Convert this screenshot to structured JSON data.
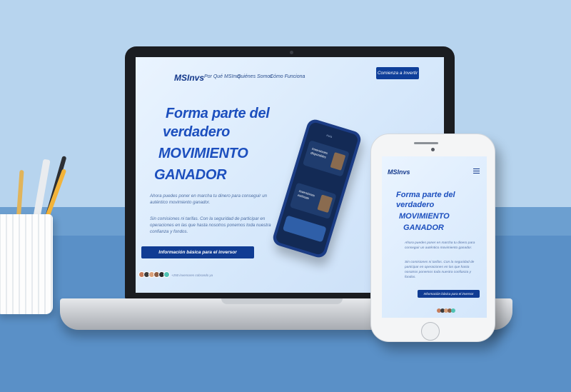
{
  "laptop_site": {
    "logo": "MSInvs",
    "nav": [
      "Por Qué MSInvs",
      "Quiénes Somos",
      "Cómo Funciona"
    ],
    "cta": "Comienza a Invertir",
    "headline": [
      "Forma parte del",
      "verdadero",
      "MOVIMIENTO",
      "GANADOR"
    ],
    "paragraph_1": "Ahora puedes poner en marcha tu dinero para conseguir un auténtico movimiento ganador.",
    "paragraph_2": "Sin comisiones ni tarifas. Con la seguridad de participar en operaciones en las que hasta nosotros ponemos toda nuestra confianza y fondos.",
    "button": "Información básica para el inversor",
    "avatar_note": "+250 inversores cobrando ya"
  },
  "inner_phone": {
    "card_1": "Inversiones disponibles",
    "card_2": "Inversiones exitosas",
    "header": "Hola"
  },
  "phone_site": {
    "logo": "MSInvs",
    "headline": [
      "Forma parte del",
      "verdadero",
      "MOVIMIENTO",
      "GANADOR"
    ],
    "paragraph_1": "Ahora puedes poner en marcha tu dinero para conseguir un auténtico movimiento ganador.",
    "paragraph_2": "Sin comisiones ni tarifas. Con la seguridad de participar en operaciones en las que hasta nosotros ponemos toda nuestra confianza y fondos.",
    "button": "Información básica para el inversor"
  },
  "colors": {
    "brand": "#1c4fbe",
    "button": "#103c93",
    "background_wall": "#b7d4ee",
    "background_desk": "#5a90c7"
  }
}
